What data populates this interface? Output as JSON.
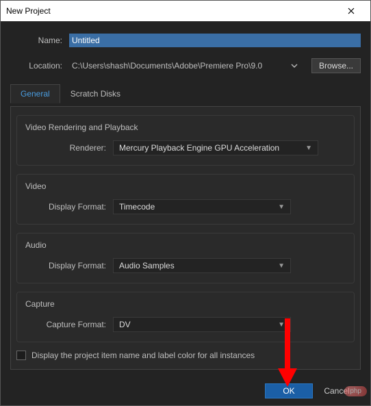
{
  "title": "New Project",
  "name_label": "Name:",
  "name_value": "Untitled",
  "location_label": "Location:",
  "location_value": "C:\\Users\\shash\\Documents\\Adobe\\Premiere Pro\\9.0",
  "browse_label": "Browse...",
  "tabs": {
    "general": "General",
    "scratch": "Scratch Disks"
  },
  "groups": {
    "render": {
      "title": "Video Rendering and Playback",
      "label": "Renderer:",
      "value": "Mercury Playback Engine GPU Acceleration"
    },
    "video": {
      "title": "Video",
      "label": "Display Format:",
      "value": "Timecode"
    },
    "audio": {
      "title": "Audio",
      "label": "Display Format:",
      "value": "Audio Samples"
    },
    "capture": {
      "title": "Capture",
      "label": "Capture Format:",
      "value": "DV"
    }
  },
  "checkbox_label": "Display the project item name and label color for all instances",
  "buttons": {
    "ok": "OK",
    "cancel": "Cancel"
  },
  "watermark": "php"
}
